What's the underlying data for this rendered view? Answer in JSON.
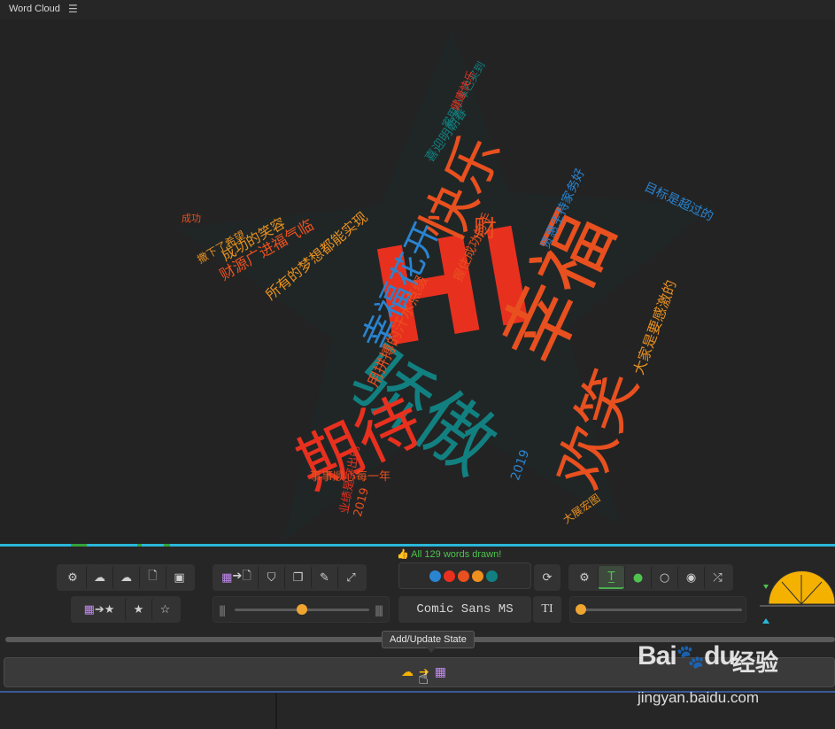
{
  "window": {
    "title": "Word Cloud",
    "menu_icon": "hamburger-icon"
  },
  "cloud": {
    "words": [
      {
        "text": "HI",
        "color": "#e8301f"
      },
      {
        "text": "幸福",
        "color": "#e8501f"
      },
      {
        "text": "骄傲",
        "color": "#128080"
      },
      {
        "text": "期待",
        "color": "#e8301f"
      },
      {
        "text": "欢笑",
        "color": "#e8501f"
      },
      {
        "text": "快乐",
        "color": "#e8501f"
      },
      {
        "text": "幸福花开",
        "color": "#2a84d0"
      },
      {
        "text": "财",
        "color": "#e8501f"
      },
      {
        "text": "成功的笑容",
        "color": "#e8901f"
      },
      {
        "text": "财源广进福气临",
        "color": "#e8501f"
      },
      {
        "text": "所有的梦想都能实现",
        "color": "#e8901f"
      },
      {
        "text": "用拼搏的汗水点缀",
        "color": "#e8501f"
      },
      {
        "text": "大家是要感激的",
        "color": "#e8901f"
      },
      {
        "text": "目标是超过的",
        "color": "#2a84d0"
      },
      {
        "text": "贤惠主持家务好",
        "color": "#2a84d0"
      },
      {
        "text": "握住成功的手",
        "color": "#e8501f"
      },
      {
        "text": "2019",
        "color": "#2a84d0"
      },
      {
        "text": "2019",
        "color": "#e8501f"
      },
      {
        "text": "事事顺心每一年",
        "color": "#e8501f"
      },
      {
        "text": "业绩是突出的",
        "color": "#e8301f"
      },
      {
        "text": "大展宏图",
        "color": "#e8901f"
      },
      {
        "text": "喜迎明朝春",
        "color": "#128080"
      },
      {
        "text": "家用小车已买到",
        "color": "#128080"
      },
      {
        "text": "健康快乐",
        "color": "#e8301f"
      },
      {
        "text": "撒下了希望",
        "color": "#e8901f"
      },
      {
        "text": "成功",
        "color": "#e8501f"
      }
    ]
  },
  "status": {
    "text": "All 129 words drawn!",
    "icon": "thumbs-up-icon"
  },
  "toolbar": {
    "group1": [
      "gear-icon",
      "cloud-download-icon",
      "cloud-upload-icon",
      "file-code-icon",
      "image-icon"
    ],
    "group2": [
      "film-to-file-icon",
      "html5-icon",
      "copy-icon",
      "edit-icon",
      "expand-icon"
    ],
    "group3": [
      "film-to-star-icon",
      "star-icon",
      "star-outline-icon"
    ],
    "palette_colors": [
      "#2a84d0",
      "#e8301f",
      "#e8501f",
      "#f0901f",
      "#128080"
    ],
    "refresh_icon": "refresh-icon",
    "group4": [
      "cogs-icon",
      "text-icon",
      "dot-circle-icon",
      "circle-icon",
      "target-icon",
      "shuffle-icon"
    ],
    "font_name": "Comic Sans MS",
    "font_btn": "TI",
    "size_slider_fraction": 0.55,
    "right_slider_fraction": 0.0
  },
  "state": {
    "tooltip": "Add/Update State",
    "icons": [
      "cloud-icon",
      "arrow-right-icon",
      "film-icon"
    ]
  },
  "watermark": {
    "brand": "Bai",
    "brand2": "du",
    "brand_cn": "经验",
    "url": "jingyan.baidu.com"
  },
  "colors": {
    "accent": "#f0a530",
    "progress": "#2ab7d8",
    "success": "#4fc24f"
  }
}
